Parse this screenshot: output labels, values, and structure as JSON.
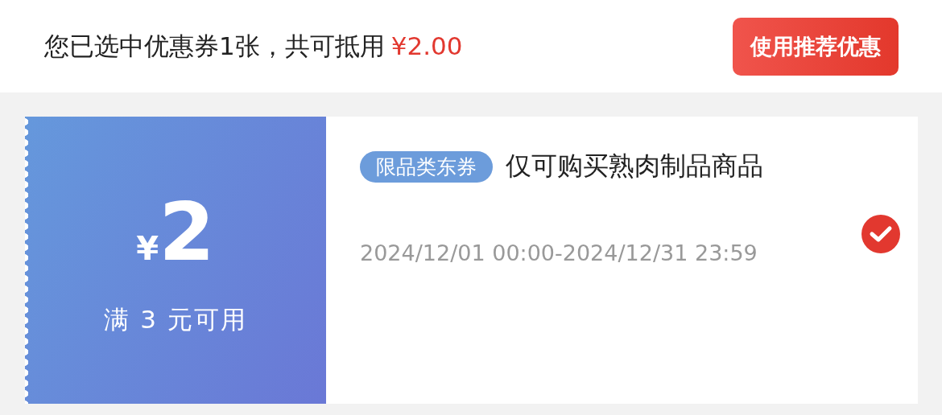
{
  "summary": {
    "text": "您已选中优惠券1张，共可抵用",
    "amount": "¥2.00"
  },
  "recommend_button": {
    "label": "使用推荐优惠"
  },
  "coupons": [
    {
      "currency": "¥",
      "value": "2",
      "condition": "满 3 元可用",
      "tag": "限品类东券",
      "description": "仅可购买熟肉制品商品",
      "validity": "2024/12/01 00:00-2024/12/31 23:59",
      "selected": true
    }
  ]
}
